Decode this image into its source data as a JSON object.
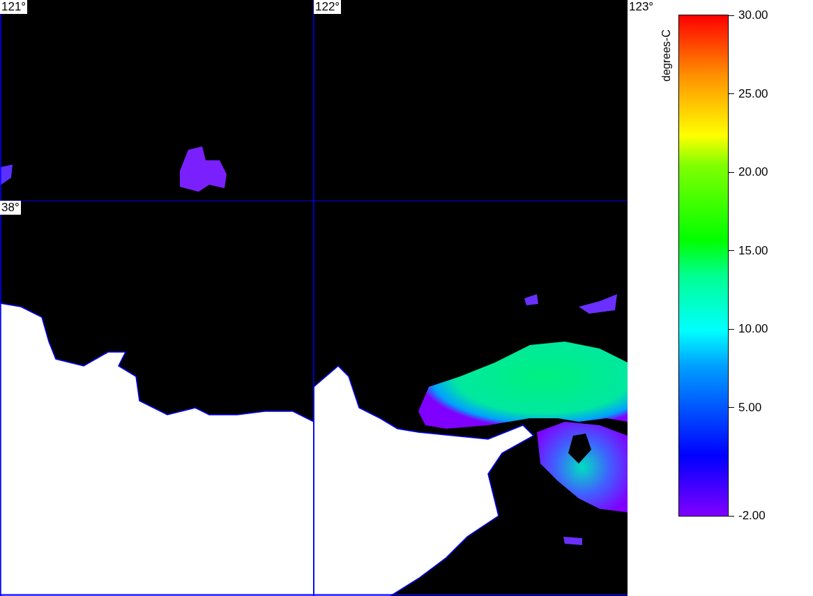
{
  "map": {
    "longitude_labels": [
      "121°",
      "122°",
      "123°"
    ],
    "latitude_labels": [
      "38°"
    ]
  },
  "legend": {
    "title": "degrees-C",
    "ticks": [
      "30.00",
      "25.00",
      "20.00",
      "15.00",
      "10.00",
      "5.00",
      "-2.00"
    ]
  }
}
